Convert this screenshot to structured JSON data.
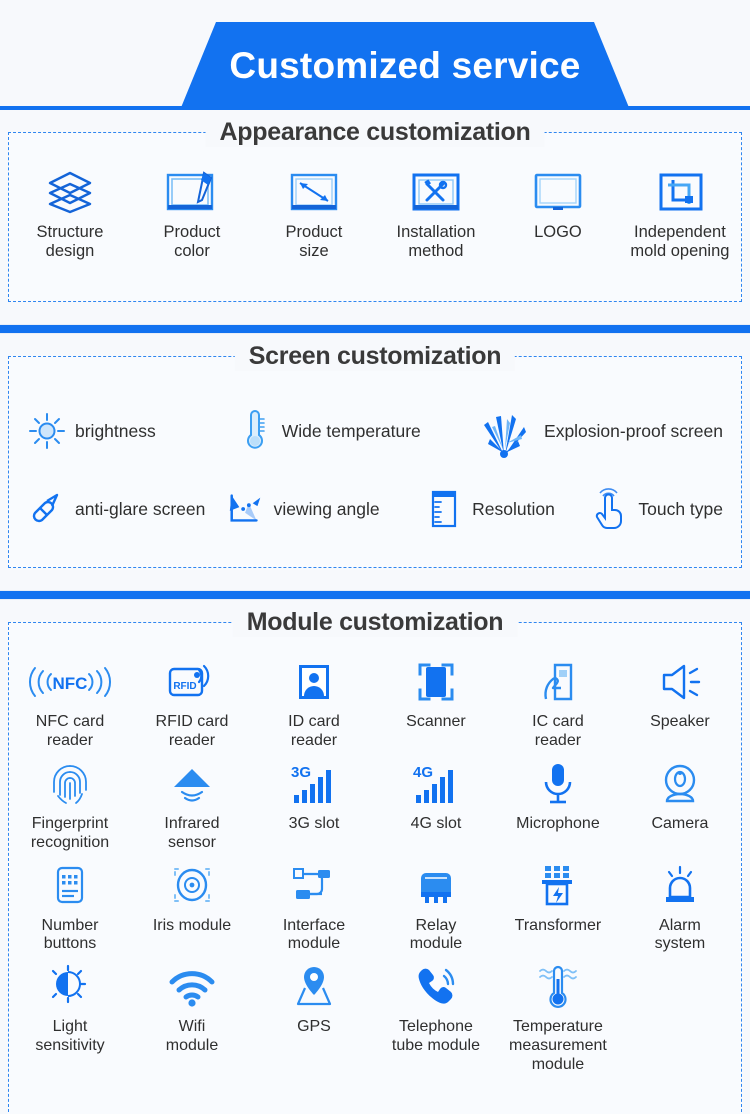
{
  "banner": {
    "title": "Customized service"
  },
  "colors": {
    "brand_blue": "#1272f0",
    "icon_blue": "#2b8cf0",
    "icon_deep_blue": "#1464d8",
    "page_bg": "#f7f9fc",
    "section_bg": "#f9fbfe",
    "dashed_border": "#2f86f0",
    "title_text": "#3a3a3a",
    "label_text": "#2f2f2f"
  },
  "sections": [
    {
      "id": "appearance",
      "title": "Appearance customization",
      "items": [
        {
          "label": "Structure\ndesign",
          "icon": "layers-icon"
        },
        {
          "label": "Product\ncolor",
          "icon": "product-color-icon"
        },
        {
          "label": "Product\nsize",
          "icon": "product-size-icon"
        },
        {
          "label": "Installation\nmethod",
          "icon": "tools-icon"
        },
        {
          "label": "LOGO",
          "icon": "monitor-icon"
        },
        {
          "label": "Independent\nmold opening",
          "icon": "crop-icon"
        }
      ]
    },
    {
      "id": "screen",
      "title": "Screen customization",
      "rows": [
        [
          {
            "label": "brightness",
            "icon": "sun-icon"
          },
          {
            "label": "Wide temperature",
            "icon": "thermometer-icon"
          },
          {
            "label": "Explosion-proof screen",
            "icon": "shatter-icon"
          }
        ],
        [
          {
            "label": "anti-glare screen",
            "icon": "anti-glare-icon"
          },
          {
            "label": "viewing angle",
            "icon": "viewing-angle-icon"
          },
          {
            "label": "Resolution",
            "icon": "ruler-icon"
          },
          {
            "label": "Touch type",
            "icon": "touch-hand-icon"
          }
        ]
      ]
    },
    {
      "id": "module",
      "title": "Module customization",
      "rows": [
        [
          {
            "label": "NFC card\nreader",
            "icon": "nfc-icon"
          },
          {
            "label": "RFID card\nreader",
            "icon": "rfid-icon"
          },
          {
            "label": "ID card\nreader",
            "icon": "id-card-icon"
          },
          {
            "label": "Scanner",
            "icon": "scanner-icon"
          },
          {
            "label": "IC card\nreader",
            "icon": "ic-card-icon"
          },
          {
            "label": "Speaker",
            "icon": "speaker-icon"
          }
        ],
        [
          {
            "label": "Fingerprint\nrecognition",
            "icon": "fingerprint-icon"
          },
          {
            "label": "Infrared\nsensor",
            "icon": "infrared-icon"
          },
          {
            "label": "3G slot",
            "icon": "signal-3g-icon"
          },
          {
            "label": "4G slot",
            "icon": "signal-4g-icon"
          },
          {
            "label": "Microphone",
            "icon": "microphone-icon"
          },
          {
            "label": "Camera",
            "icon": "camera-icon"
          }
        ],
        [
          {
            "label": "Number\nbuttons",
            "icon": "keypad-icon"
          },
          {
            "label": "Iris module",
            "icon": "iris-icon"
          },
          {
            "label": "Interface\nmodule",
            "icon": "usb-interface-icon"
          },
          {
            "label": "Relay\nmodule",
            "icon": "relay-icon"
          },
          {
            "label": "Transformer",
            "icon": "transformer-icon"
          },
          {
            "label": "Alarm\nsystem",
            "icon": "alarm-icon"
          }
        ],
        [
          {
            "label": "Light\nsensitivity",
            "icon": "light-sensor-icon"
          },
          {
            "label": "Wifi\nmodule",
            "icon": "wifi-icon"
          },
          {
            "label": "GPS",
            "icon": "gps-pin-icon"
          },
          {
            "label": "Telephone\ntube module",
            "icon": "telephone-icon"
          },
          {
            "label": "Temperature\nmeasurement module",
            "icon": "temperature-measure-icon"
          }
        ]
      ]
    }
  ]
}
